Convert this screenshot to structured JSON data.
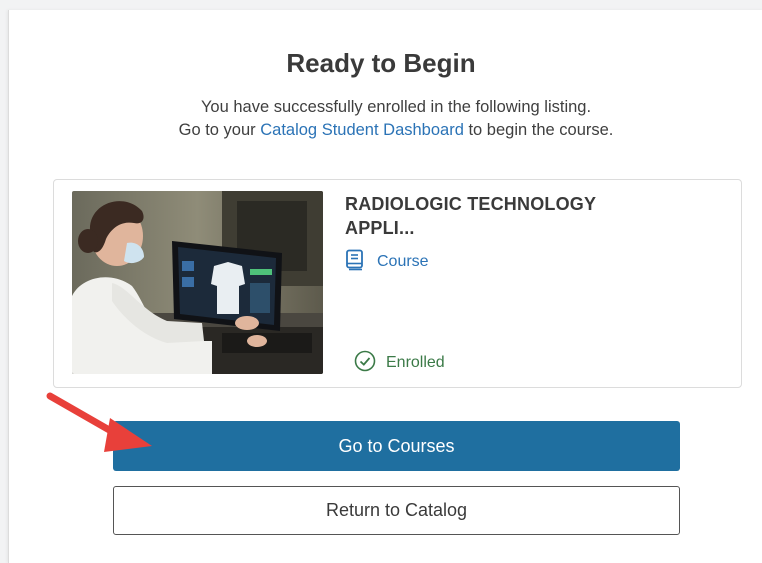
{
  "header": {
    "title": "Ready to Begin",
    "line1": "You have successfully enrolled in the following listing.",
    "line2_prefix": "Go to your ",
    "line2_link": "Catalog Student Dashboard",
    "line2_suffix": " to begin the course."
  },
  "listing": {
    "title_line1": "RADIOLOGIC TECHNOLOGY",
    "title_line2": "APPLI...",
    "type_icon": "book-icon",
    "type_label": "Course",
    "status_icon": "check-circle-icon",
    "status_label": "Enrolled"
  },
  "actions": {
    "primary_label": "Go to Courses",
    "secondary_label": "Return to Catalog"
  },
  "annotation": {
    "arrow_icon": "red-arrow-icon"
  },
  "colors": {
    "link": "#2b73b6",
    "primary_button": "#1f6fa0",
    "enrolled": "#3b7a47",
    "arrow": "#e8403a"
  }
}
